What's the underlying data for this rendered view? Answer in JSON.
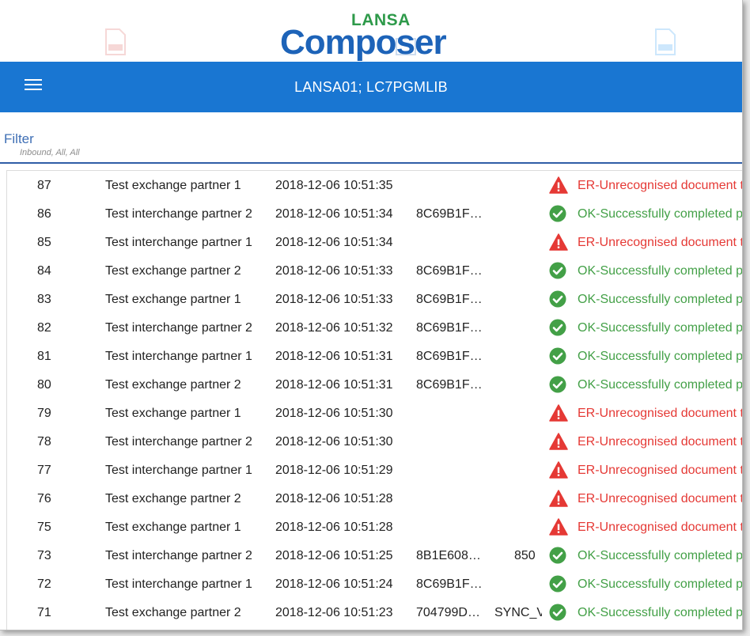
{
  "header": {
    "logo_top": "LANSA",
    "logo_main": "Composer",
    "title": "LANSA01; LC7PGMLIB"
  },
  "filter": {
    "label": "Filter",
    "summary": "Inbound, All, All"
  },
  "colors": {
    "appbar": "#1976d2",
    "ok": "#43a047",
    "error": "#e53935",
    "filter_label": "#3f6fb5"
  },
  "rows": [
    {
      "num": "87",
      "partner": "Test exchange partner 1",
      "date": "2018-12-06 10:51:35",
      "doc": "",
      "type": "",
      "code": "",
      "status": "error",
      "status_text": "ER-Unrecognised document t"
    },
    {
      "num": "86",
      "partner": "Test interchange partner 2",
      "date": "2018-12-06 10:51:34",
      "doc": "8C69B1F…",
      "type": "",
      "code": "",
      "status": "ok",
      "status_text": "OK-Successfully completed p"
    },
    {
      "num": "85",
      "partner": "Test interchange partner 1",
      "date": "2018-12-06 10:51:34",
      "doc": "",
      "type": "",
      "code": "",
      "status": "error",
      "status_text": "ER-Unrecognised document t"
    },
    {
      "num": "84",
      "partner": "Test exchange partner 2",
      "date": "2018-12-06 10:51:33",
      "doc": "8C69B1F…",
      "type": "",
      "code": "",
      "status": "ok",
      "status_text": "OK-Successfully completed p"
    },
    {
      "num": "83",
      "partner": "Test exchange partner 1",
      "date": "2018-12-06 10:51:33",
      "doc": "8C69B1F…",
      "type": "",
      "code": "",
      "status": "ok",
      "status_text": "OK-Successfully completed p"
    },
    {
      "num": "82",
      "partner": "Test interchange partner 2",
      "date": "2018-12-06 10:51:32",
      "doc": "8C69B1F…",
      "type": "",
      "code": "",
      "status": "ok",
      "status_text": "OK-Successfully completed p"
    },
    {
      "num": "81",
      "partner": "Test interchange partner 1",
      "date": "2018-12-06 10:51:31",
      "doc": "8C69B1F…",
      "type": "",
      "code": "",
      "status": "ok",
      "status_text": "OK-Successfully completed p"
    },
    {
      "num": "80",
      "partner": "Test exchange partner 2",
      "date": "2018-12-06 10:51:31",
      "doc": "8C69B1F…",
      "type": "",
      "code": "",
      "status": "ok",
      "status_text": "OK-Successfully completed p"
    },
    {
      "num": "79",
      "partner": "Test exchange partner 1",
      "date": "2018-12-06 10:51:30",
      "doc": "",
      "type": "",
      "code": "",
      "status": "error",
      "status_text": "ER-Unrecognised document t"
    },
    {
      "num": "78",
      "partner": "Test interchange partner 2",
      "date": "2018-12-06 10:51:30",
      "doc": "",
      "type": "",
      "code": "",
      "status": "error",
      "status_text": "ER-Unrecognised document t"
    },
    {
      "num": "77",
      "partner": "Test interchange partner 1",
      "date": "2018-12-06 10:51:29",
      "doc": "",
      "type": "",
      "code": "",
      "status": "error",
      "status_text": "ER-Unrecognised document t"
    },
    {
      "num": "76",
      "partner": "Test exchange partner 2",
      "date": "2018-12-06 10:51:28",
      "doc": "",
      "type": "",
      "code": "",
      "status": "error",
      "status_text": "ER-Unrecognised document t"
    },
    {
      "num": "75",
      "partner": "Test exchange partner 1",
      "date": "2018-12-06 10:51:28",
      "doc": "",
      "type": "",
      "code": "",
      "status": "error",
      "status_text": "ER-Unrecognised document t"
    },
    {
      "num": "73",
      "partner": "Test interchange partner 2",
      "date": "2018-12-06 10:51:25",
      "doc": "8B1E608…",
      "type": "",
      "code": "850",
      "status": "ok",
      "status_text": "OK-Successfully completed p"
    },
    {
      "num": "72",
      "partner": "Test interchange partner 1",
      "date": "2018-12-06 10:51:24",
      "doc": "8C69B1F…",
      "type": "",
      "code": "",
      "status": "ok",
      "status_text": "OK-Successfully completed p"
    },
    {
      "num": "71",
      "partner": "Test exchange partner 2",
      "date": "2018-12-06 10:51:23",
      "doc": "704799D…",
      "type": "SYNC_VI",
      "code": "",
      "status": "ok",
      "status_text": "OK-Successfully completed p"
    }
  ]
}
